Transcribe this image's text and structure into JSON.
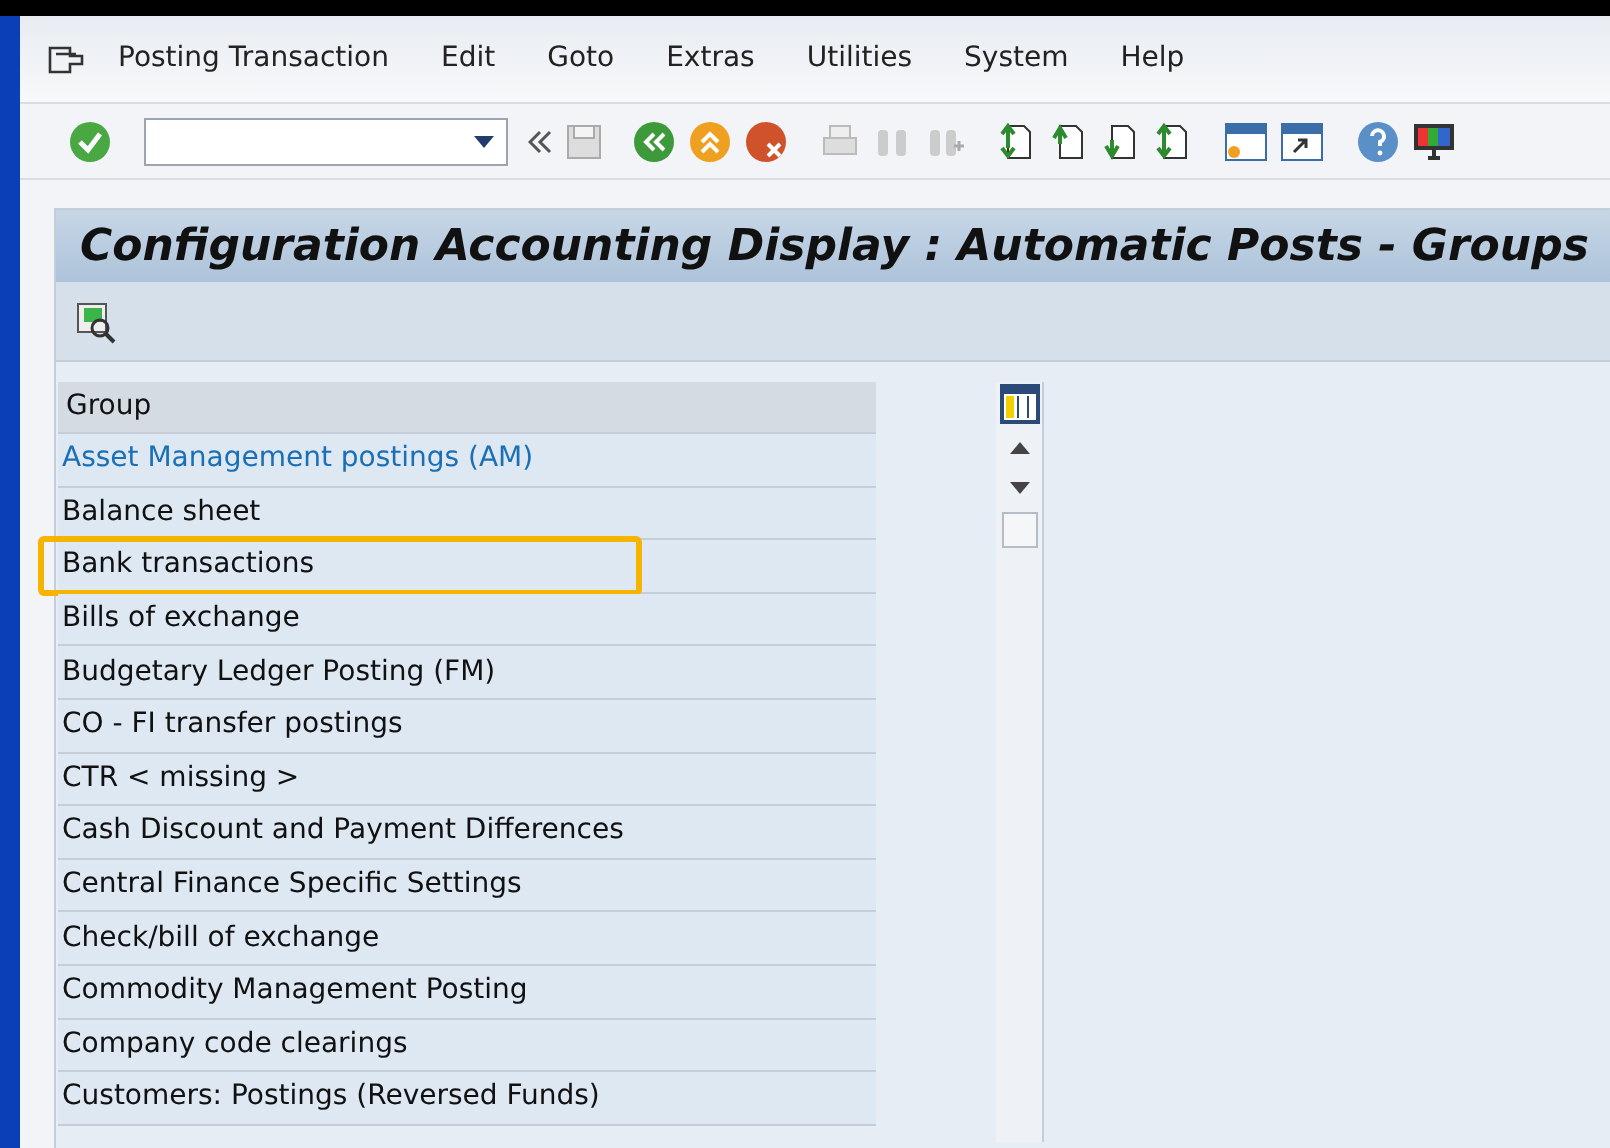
{
  "menu_bar": {
    "items": [
      "Posting Transaction",
      "Edit",
      "Goto",
      "Extras",
      "Utilities",
      "System",
      "Help"
    ]
  },
  "title": "Configuration Accounting Display : Automatic Posts - Groups",
  "table": {
    "columns": [
      "Group"
    ],
    "rows": [
      {
        "label": "Asset Management postings (AM)",
        "kind": "link",
        "selected": false
      },
      {
        "label": "Balance sheet",
        "kind": "text",
        "selected": false
      },
      {
        "label": "Bank transactions",
        "kind": "text",
        "selected": true
      },
      {
        "label": "Bills of exchange",
        "kind": "text",
        "selected": false
      },
      {
        "label": "Budgetary Ledger Posting (FM)",
        "kind": "text",
        "selected": false
      },
      {
        "label": "CO - FI transfer postings",
        "kind": "text",
        "selected": false
      },
      {
        "label": "CTR < missing >",
        "kind": "text",
        "selected": false
      },
      {
        "label": "Cash Discount and Payment Differences",
        "kind": "text",
        "selected": false
      },
      {
        "label": "Central Finance Specific Settings",
        "kind": "text",
        "selected": false
      },
      {
        "label": "Check/bill of exchange",
        "kind": "text",
        "selected": false
      },
      {
        "label": "Commodity Management Posting",
        "kind": "text",
        "selected": false
      },
      {
        "label": "Company code clearings",
        "kind": "text",
        "selected": false
      },
      {
        "label": "Customers: Postings (Reversed Funds)",
        "kind": "text",
        "selected": false
      }
    ]
  }
}
